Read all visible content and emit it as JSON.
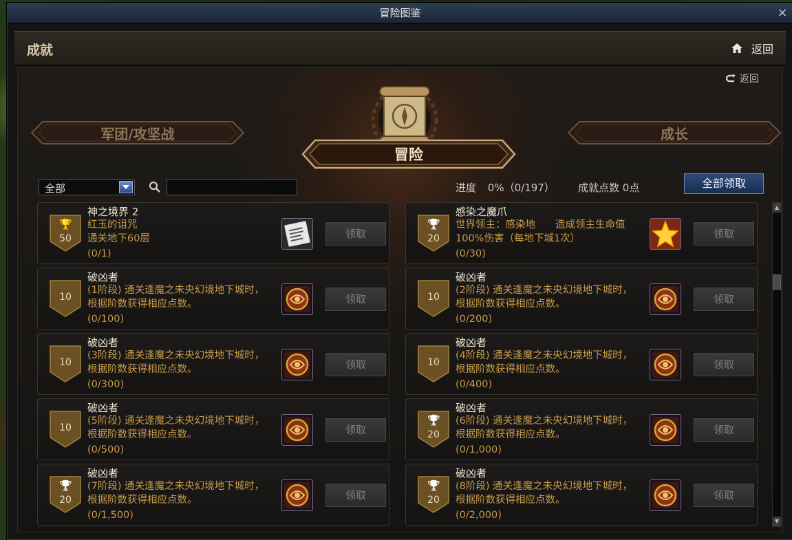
{
  "window": {
    "title": "冒险图鉴",
    "close_label": "×"
  },
  "header": {
    "title": "成就",
    "back_label": "返回"
  },
  "sub_back_label": "返回",
  "categories": {
    "left": "军团/攻坚战",
    "center": "冒险",
    "right": "成长"
  },
  "filter": {
    "selected": "全部",
    "search_value": ""
  },
  "progress": {
    "label": "进度",
    "value": "0%（0/197）"
  },
  "points": {
    "label": "成就点数",
    "value": "0点"
  },
  "claim_all_label": "全部领取",
  "achievements": [
    {
      "title": "神之境界 2",
      "desc": "红玉的诅咒\n通关地下60层",
      "progress": "(0/1)",
      "points": "50",
      "trophy": "gold",
      "reward": "scroll-item-icon",
      "button": "领取"
    },
    {
      "title": "感染之魔爪",
      "desc": "世界领主：感染地　　造成领主生命值100%伤害（每地下城1次）",
      "progress": "(0/30)",
      "points": "20",
      "trophy": "silver",
      "reward": "gold-crystal-icon",
      "button": "领取"
    },
    {
      "title": "破凶者",
      "desc": "(1阶段) 通关逢魔之未央幻境地下城时，根据阶数获得相应点数。",
      "progress": "(0/100)",
      "points": "10",
      "trophy": "none",
      "reward": "emblem-icon",
      "button": "领取"
    },
    {
      "title": "破凶者",
      "desc": "(2阶段) 通关逢魔之未央幻境地下城时，根据阶数获得相应点数。",
      "progress": "(0/200)",
      "points": "10",
      "trophy": "none",
      "reward": "emblem-icon",
      "button": "领取"
    },
    {
      "title": "破凶者",
      "desc": "(3阶段) 通关逢魔之未央幻境地下城时，根据阶数获得相应点数。",
      "progress": "(0/300)",
      "points": "10",
      "trophy": "none",
      "reward": "emblem-icon",
      "button": "领取"
    },
    {
      "title": "破凶者",
      "desc": "(4阶段) 通关逢魔之未央幻境地下城时，根据阶数获得相应点数。",
      "progress": "(0/400)",
      "points": "10",
      "trophy": "none",
      "reward": "emblem-icon",
      "button": "领取"
    },
    {
      "title": "破凶者",
      "desc": "(5阶段) 通关逢魔之未央幻境地下城时，根据阶数获得相应点数。",
      "progress": "(0/500)",
      "points": "10",
      "trophy": "none",
      "reward": "emblem-icon",
      "button": "领取"
    },
    {
      "title": "破凶者",
      "desc": "(6阶段) 通关逢魔之未央幻境地下城时，根据阶数获得相应点数。",
      "progress": "(0/1,000)",
      "points": "20",
      "trophy": "silver",
      "reward": "emblem-icon",
      "button": "领取"
    },
    {
      "title": "破凶者",
      "desc": "(7阶段) 通关逢魔之未央幻境地下城时，根据阶数获得相应点数。",
      "progress": "(0/1,500)",
      "points": "20",
      "trophy": "silver",
      "reward": "emblem-icon",
      "button": "领取"
    },
    {
      "title": "破凶者",
      "desc": "(8阶段) 通关逢魔之未央幻境地下城时，根据阶数获得相应点数。",
      "progress": "(0/2,000)",
      "points": "20",
      "trophy": "silver",
      "reward": "emblem-icon",
      "button": "领取"
    }
  ],
  "colors": {
    "accent_gold": "#c89a4a",
    "claim_all_blue": "#2f4a78",
    "trophy_gold": "#e0b030",
    "trophy_silver": "#cfcfcf"
  }
}
